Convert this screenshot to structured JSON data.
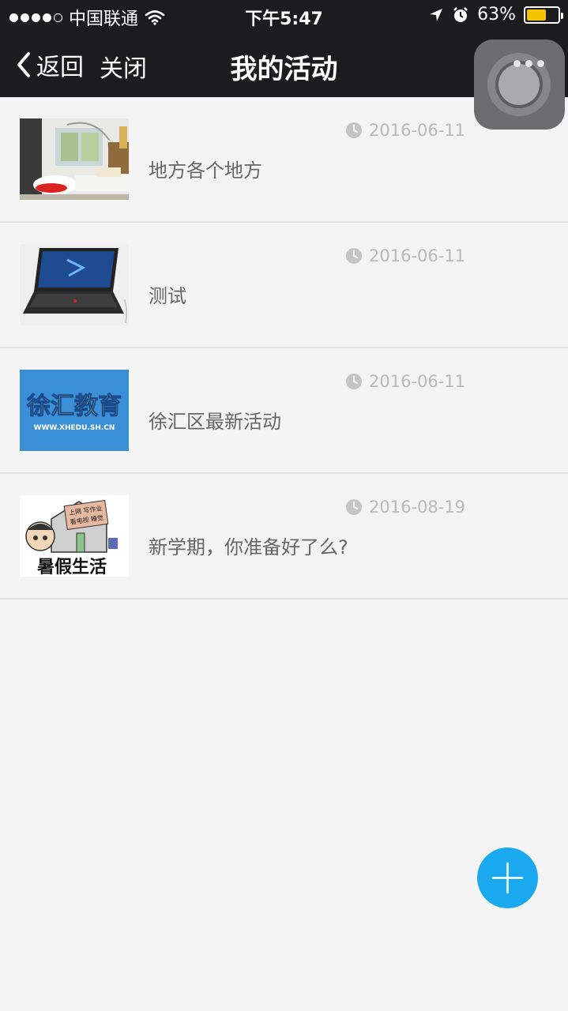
{
  "status_bar": {
    "carrier": "中国联通",
    "time": "下午5:47",
    "battery_percent": "63%",
    "battery_level": 0.63,
    "icons": [
      "signal-dots-icon",
      "wifi-icon",
      "location-arrow-icon",
      "alarm-icon",
      "battery-icon"
    ]
  },
  "nav": {
    "back_label": "返回",
    "close_label": "关闭",
    "title": "我的活动",
    "more_icon": "more-dots-icon"
  },
  "activities": [
    {
      "date": "2016-06-11",
      "name": "地方各个地方",
      "thumb": "living-room-photo"
    },
    {
      "date": "2016-06-11",
      "name": "测试",
      "thumb": "laptop-photo"
    },
    {
      "date": "2016-06-11",
      "name": "徐汇区最新活动",
      "thumb": "xuhui-education-logo",
      "thumb_text": {
        "title": "徐汇教育",
        "url": "WWW.XHEDU.SH.CN"
      }
    },
    {
      "date": "2016-08-19",
      "name": "新学期，你准备好了么?",
      "thumb": "summer-life-cartoon",
      "thumb_text": {
        "sign_line1": "上网 写作业",
        "sign_line2": "看电视 睡觉",
        "caption": "暑假生活"
      }
    }
  ],
  "fab": {
    "icon": "plus-icon"
  },
  "colors": {
    "header_bg": "#1c1c1f",
    "page_bg": "#f4f4f4",
    "fab": "#1aa9ee",
    "battery": "#f5c400"
  }
}
